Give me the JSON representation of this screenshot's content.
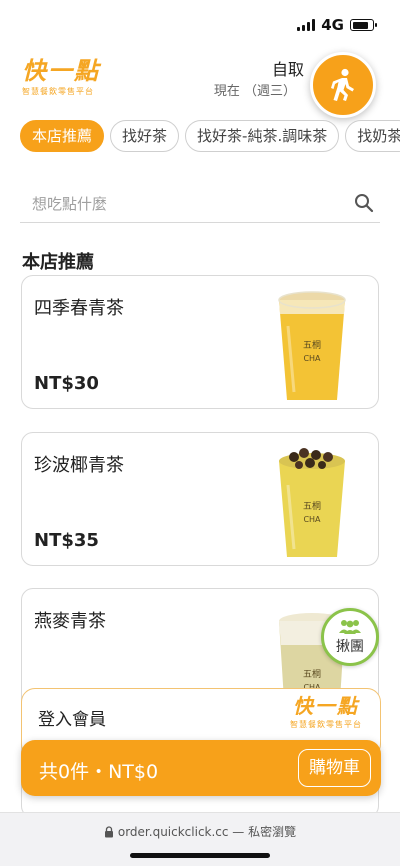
{
  "status_bar": {
    "network": "4G",
    "signal_bars": 4,
    "battery_level": 0.85
  },
  "header": {
    "logo_text": "快一點",
    "logo_subtitle": "智慧餐飲零售平台",
    "pickup_mode": "自取",
    "pickup_time": "現在 （週三）",
    "walk_button_icon": "walking-person-icon"
  },
  "tabs": [
    {
      "label": "本店推薦",
      "active": true
    },
    {
      "label": "找好茶",
      "active": false
    },
    {
      "label": "找好茶-純茶.調味茶",
      "active": false
    },
    {
      "label": "找奶茶",
      "active": false
    }
  ],
  "search": {
    "placeholder": "想吃點什麼",
    "value": ""
  },
  "section_title": "本店推薦",
  "products": [
    {
      "name": "四季春青茶",
      "price": "NT$30",
      "drink_color": "#f2c02a",
      "topping": "foam"
    },
    {
      "name": "珍波椰青茶",
      "price": "NT$35",
      "drink_color": "#e9d34a",
      "topping": "pearls"
    },
    {
      "name": "燕麥青茶",
      "price": "",
      "drink_color": "#ddd6a2",
      "topping": "oat"
    }
  ],
  "group_order": {
    "label": "揪團",
    "icon": "group-people-icon",
    "color": "#8bc34a"
  },
  "member": {
    "label": "登入會員"
  },
  "cart": {
    "summary": "共0件・NT$0",
    "button_label": "購物車"
  },
  "browser": {
    "url": "order.quickclick.cc — 私密瀏覽"
  },
  "colors": {
    "accent": "#f7a11a",
    "group_green": "#8bc34a"
  }
}
